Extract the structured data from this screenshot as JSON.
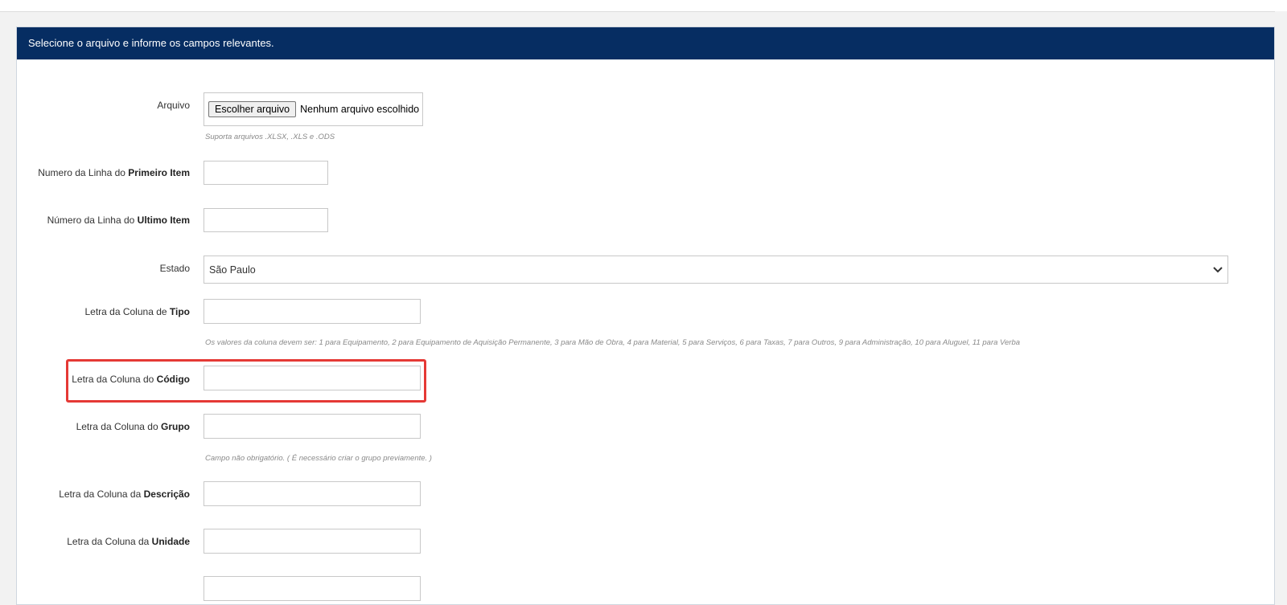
{
  "panel": {
    "title": "Selecione o arquivo e informe os campos relevantes."
  },
  "fields": {
    "arquivo": {
      "label": "Arquivo",
      "button_label": "Escolher arquivo",
      "status": "Nenhum arquivo escolhido",
      "hint": "Suporta arquivos .XLSX, .XLS e .ODS"
    },
    "primeiro_item": {
      "label_prefix": "Numero da Linha do ",
      "label_bold": "Primeiro Item",
      "value": ""
    },
    "ultimo_item": {
      "label_prefix": "Número da Linha do ",
      "label_bold": "Ultimo Item",
      "value": ""
    },
    "estado": {
      "label": "Estado",
      "selected": "São Paulo"
    },
    "tipo": {
      "label_prefix": "Letra da Coluna de ",
      "label_bold": "Tipo",
      "value": "",
      "hint": "Os valores da coluna devem ser: 1 para Equipamento, 2 para Equipamento de Aquisição Permanente, 3 para Mão de Obra, 4 para Material, 5 para Serviços, 6 para Taxas, 7 para Outros, 9 para Administração, 10 para Aluguel, 11 para Verba"
    },
    "codigo": {
      "label_prefix": "Letra da Coluna do ",
      "label_bold": "Código",
      "value": ""
    },
    "grupo": {
      "label_prefix": "Letra da Coluna do ",
      "label_bold": "Grupo",
      "value": "",
      "hint": "Campo não obrigatório. ( É necessário criar o grupo previamente. )"
    },
    "descricao": {
      "label_prefix": "Letra da Coluna da ",
      "label_bold": "Descrição",
      "value": ""
    },
    "unidade": {
      "label_prefix": "Letra da Coluna da ",
      "label_bold": "Unidade",
      "value": ""
    }
  },
  "colors": {
    "header_bg": "#062d62",
    "highlight": "#e53935"
  },
  "icons": {
    "select_chevron": "chevron-down-icon"
  }
}
